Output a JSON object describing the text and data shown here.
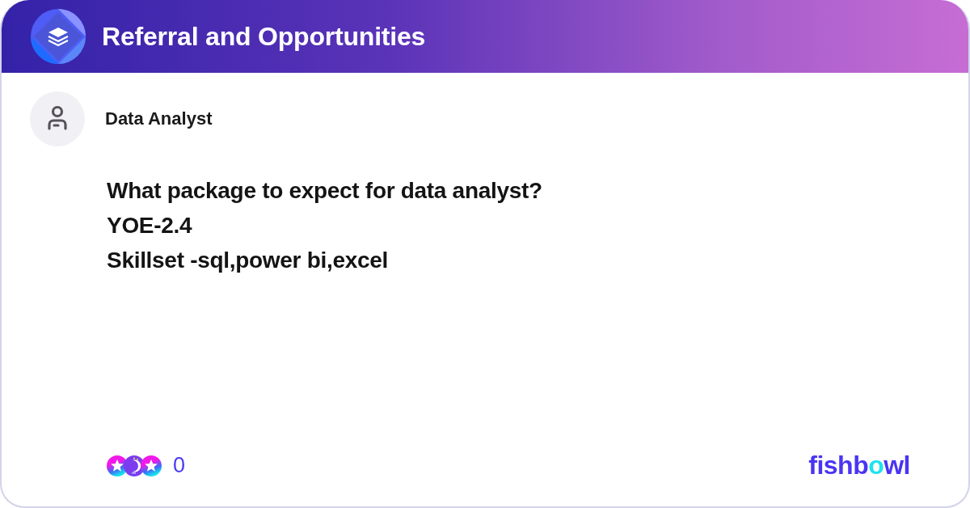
{
  "header": {
    "title": "Referral and Opportunities"
  },
  "post": {
    "author": "Data Analyst",
    "text": "What package to expect for data analyst?\nYOE-2.4\nSkillset -sql,power bi,excel"
  },
  "footer": {
    "reaction_count": "0",
    "logo": {
      "parts": [
        {
          "text": "fishb",
          "color": "#4a35f2"
        },
        {
          "text": "o",
          "color": "#1ee3ee"
        },
        {
          "text": "wl",
          "color": "#4a35f2"
        }
      ]
    }
  }
}
